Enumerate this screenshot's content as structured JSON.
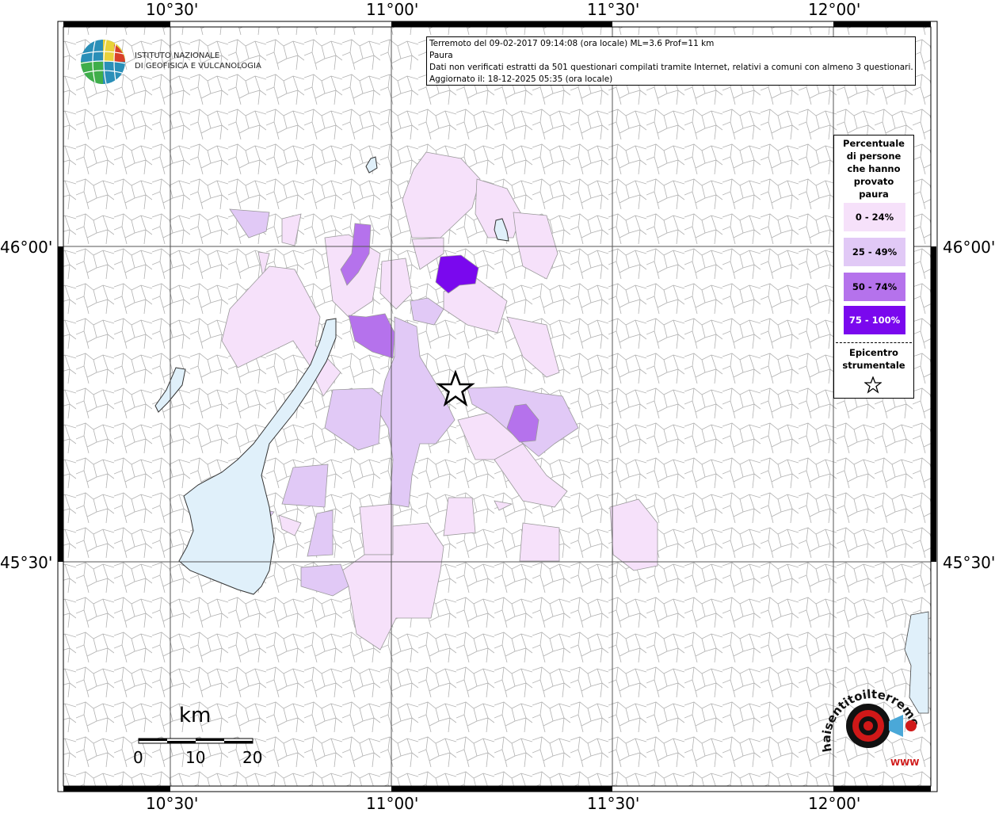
{
  "map": {
    "lon_labels": [
      "10°30'",
      "11°00'",
      "11°30'",
      "12°00'"
    ],
    "lat_labels": [
      "46°00'",
      "45°30'"
    ]
  },
  "logo": {
    "line1": "ISTITUTO NAZIONALE",
    "line2": "DI GEOFISICA E VULCANOLOGIA"
  },
  "info": {
    "line1": "Terremoto del 09-02-2017 09:14:08 (ora locale) ML=3.6 Prof=11 km",
    "line2": "Paura",
    "line3": "Dati non verificati estratti da 501 questionari compilati tramite Internet, relativi a comuni con almeno 3 questionari.",
    "line4": "Aggiornato il: 18-12-2025 05:35 (ora locale)"
  },
  "legend": {
    "title_lines": [
      "Percentuale",
      "di persone",
      "che hanno",
      "provato",
      "paura"
    ],
    "classes": [
      {
        "label": "0 - 24%",
        "color": "#f6e1fa"
      },
      {
        "label": "25 - 49%",
        "color": "#e1c9f6"
      },
      {
        "label": "50 - 74%",
        "color": "#b572ec"
      },
      {
        "label": "75 - 100%",
        "color": "#7a08ee"
      }
    ],
    "epicenter_lines": [
      "Epicentro",
      "strumentale"
    ]
  },
  "scale": {
    "unit": "km",
    "ticks": [
      "0",
      "10",
      "20"
    ]
  },
  "colors": {
    "lake": "#e0f0fa",
    "boundary": "#9a9a9a",
    "frame": "#000000"
  },
  "brand": {
    "text": "haisentitoilterremoto.it",
    "url": "WWW"
  }
}
